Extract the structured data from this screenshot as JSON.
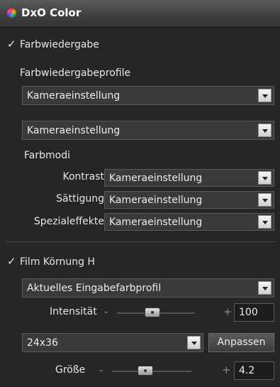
{
  "panel": {
    "title": "DxO Color"
  },
  "color_rendering": {
    "checkbox_label": "Farbwiedergabe",
    "checked": true,
    "profiles_label": "Farbwiedergabeprofile",
    "profile_select_1": "Kameraeinstellung",
    "profile_select_2": "Kameraeinstellung",
    "modes_label": "Farbmodi",
    "modes": [
      {
        "label": "Kontrast",
        "value": "Kameraeinstellung"
      },
      {
        "label": "Sättigung",
        "value": "Kameraeinstellung"
      },
      {
        "label": "Spezialeffekte",
        "value": "Kameraeinstellung"
      }
    ]
  },
  "film_grain": {
    "checkbox_label": "Film Körnung H",
    "checked": true,
    "profile_select": "Aktuelles Eingabefarbprofil",
    "intensity": {
      "label": "Intensität",
      "minus": "-",
      "plus": "+",
      "value": "100",
      "slider_fraction": 0.45
    },
    "format_select": "24x36",
    "adjust_button": "Anpassen",
    "size": {
      "label": "Größe",
      "minus": "-",
      "plus": "+",
      "value": "4.2",
      "slider_fraction": 0.42
    }
  },
  "icons": {
    "checkmark": "✓",
    "dropdown": "chevron-down-icon"
  }
}
